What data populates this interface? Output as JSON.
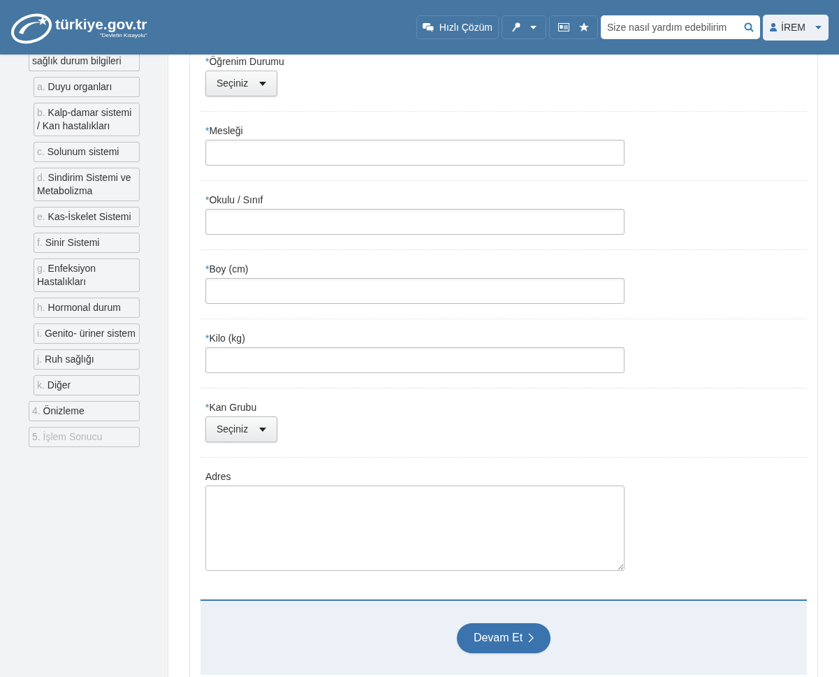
{
  "header": {
    "logo_text": "türkiye.gov.tr",
    "logo_tagline": "\"Devletin Kısayolu\"",
    "quick_solution": "Hızlı Çözüm",
    "search": {
      "placeholder": "Size nasıl yardım edebilirim"
    },
    "user": "İREM"
  },
  "sidebar": {
    "items": [
      {
        "label": "sağlık durum bilgileri",
        "disabled": false,
        "children": [
          {
            "prefix": "a.",
            "label": "Duyu organları",
            "disabled": false
          },
          {
            "prefix": "b.",
            "label": "Kalp-damar sistemi / Kan hastalıkları",
            "disabled": false
          },
          {
            "prefix": "c.",
            "label": "Solunum sistemi",
            "disabled": false
          },
          {
            "prefix": "d.",
            "label": "Sindirim Sistemi ve Metabolizma",
            "disabled": false
          },
          {
            "prefix": "e.",
            "label": "Kas-İskelet Sistemi",
            "disabled": false
          },
          {
            "prefix": "f.",
            "label": "Sinir Sistemi",
            "disabled": false
          },
          {
            "prefix": "g.",
            "label": "Enfeksiyon Hastalıkları",
            "disabled": false
          },
          {
            "prefix": "h.",
            "label": "Hormonal durum",
            "disabled": false
          },
          {
            "prefix": "i.",
            "label": "Genito- üriner sistem",
            "disabled": false
          },
          {
            "prefix": "j.",
            "label": "Ruh sağlığı",
            "disabled": false
          },
          {
            "prefix": "k.",
            "label": "Diğer",
            "disabled": false
          }
        ]
      },
      {
        "prefix": "4.",
        "label": "Önizleme",
        "disabled": false
      },
      {
        "prefix": "5.",
        "label": "İşlem Sonucu",
        "disabled": true
      }
    ]
  },
  "form": {
    "required_mark": "*",
    "fields": [
      {
        "kind": "select",
        "label": "Öğrenim Durumu",
        "required": true,
        "value": "Seçiniz"
      },
      {
        "kind": "text",
        "label": "Mesleği",
        "required": true
      },
      {
        "kind": "text",
        "label": "Okulu / Sınıf",
        "required": true
      },
      {
        "kind": "text",
        "label": "Boy (cm)",
        "required": true
      },
      {
        "kind": "text",
        "label": "Kilo (kg)",
        "required": true
      },
      {
        "kind": "select",
        "label": "Kan Grubu",
        "required": true,
        "value": "Seçiniz"
      },
      {
        "kind": "textarea",
        "label": "Adres",
        "required": false
      }
    ],
    "submit": "Devam Et"
  }
}
